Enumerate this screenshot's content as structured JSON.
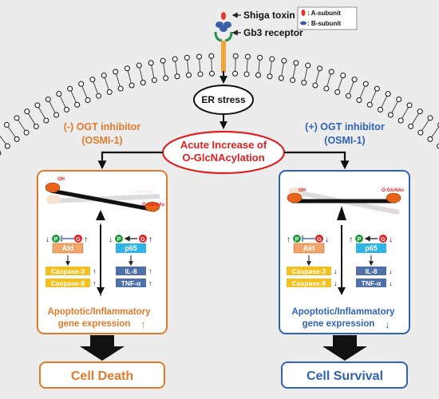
{
  "toxin": {
    "name": "Shiga toxin",
    "receptor": "Gb3 receptor",
    "legend": {
      "a_subunit": ": A-subunit",
      "b_subunit": ": B-subunit",
      "a_color": "#e8322a",
      "b_color": "#3a5fa8"
    }
  },
  "er_stress": "ER stress",
  "center": {
    "line1": "Acute Increase of",
    "line2": "O-GlcNAcylation"
  },
  "left": {
    "heading1": "(-) OGT inhibitor",
    "heading2": "(OSMI-1)",
    "oh": "OH",
    "oglcnac": "O-GlcNAc",
    "faded_top": "O-GlcNAc",
    "akt": "Akt",
    "p65": "p65",
    "casp3": "Caspase-3",
    "casp8": "Caspase-8",
    "il8": "IL-8",
    "tnf": "TNF-α",
    "p": "P",
    "g": "G",
    "expr1": "Apoptotic/Inflammatory",
    "expr2": "gene expression",
    "outcome": "Cell Death"
  },
  "right": {
    "heading1": "(+) OGT inhibitor",
    "heading2": "(OSMI-1)",
    "oh": "OH",
    "oglcnac": "O-GlcNAc",
    "faded_bottom": "O-GlcNAc",
    "akt": "Akt",
    "p65": "p65",
    "casp3": "Caspase-3",
    "casp8": "Caspase-8",
    "il8": "IL-8",
    "tnf": "TNF-α",
    "p": "P",
    "g": "G",
    "expr1": "Apoptotic/Inflammatory",
    "expr2": "gene expression",
    "outcome": "Cell Survival"
  },
  "colors": {
    "orange": "#e37a2b",
    "blue": "#2f63b6",
    "red": "#e02020",
    "green": "#1f9b3a",
    "akt_fill": "#f0a66b",
    "p65_fill": "#2fb4e6",
    "yellow": "#f3c11f",
    "inhib_blue": "#4f6fa8"
  }
}
